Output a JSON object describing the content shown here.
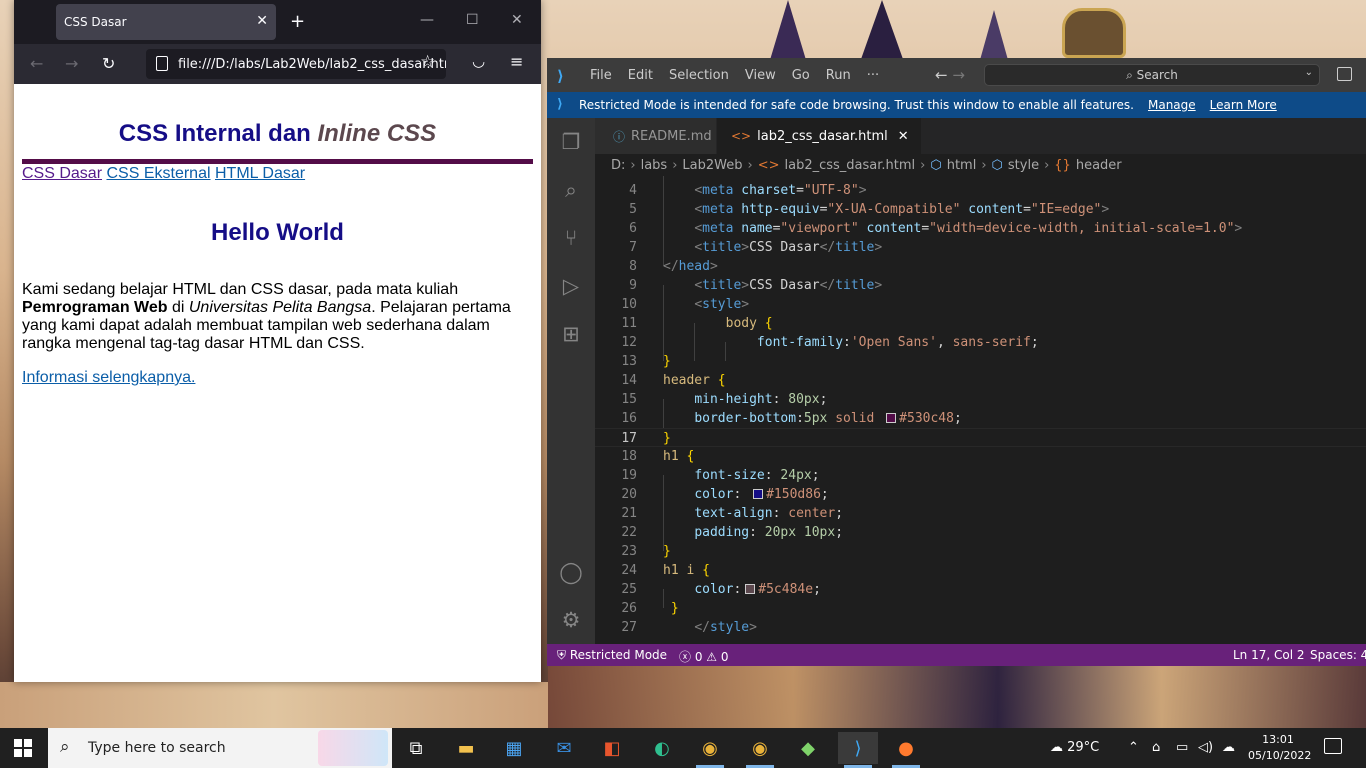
{
  "browser": {
    "tab_title": "CSS Dasar",
    "url": "file:///D:/labs/Lab2Web/lab2_css_dasar.html",
    "page": {
      "h1_text": "CSS Internal dan ",
      "h1_italic": "Inline CSS",
      "nav": [
        "CSS Dasar",
        "CSS Eksternal",
        "HTML Dasar"
      ],
      "h2": "Hello World",
      "p_part1": "Kami sedang belajar HTML dan CSS dasar, pada mata kuliah ",
      "p_bold": "Pemrograman Web",
      "p_part2": " di ",
      "p_italic": "Universitas Pelita Bangsa",
      "p_part3": ". Pelajaran pertama yang kami dapat adalah membuat tampilan web sederhana dalam rangka mengenal tag-tag dasar HTML dan CSS.",
      "more_link": "Informasi selengkapnya."
    }
  },
  "vscode": {
    "menu": [
      "File",
      "Edit",
      "Selection",
      "View",
      "Go",
      "Run",
      "···"
    ],
    "search_placeholder": "Search",
    "banner": {
      "text": "Restricted Mode is intended for safe code browsing. Trust this window to enable all features.",
      "manage": "Manage",
      "learn_more": "Learn More"
    },
    "tabs": [
      {
        "label": "README.md",
        "active": false
      },
      {
        "label": "lab2_css_dasar.html",
        "active": true
      }
    ],
    "breadcrumb": [
      "D:",
      "labs",
      "Lab2Web",
      "lab2_css_dasar.html",
      "html",
      "style",
      "header"
    ],
    "status": {
      "restricted": "Restricted Mode",
      "errors": "0",
      "warnings": "0",
      "position": "Ln 17, Col 2",
      "spaces": "Spaces: 4"
    },
    "current_line": 17,
    "colors": {
      "header_border": "#530c48",
      "h1_color": "#150d86",
      "h1_i_color": "#5c484e"
    }
  },
  "taskbar": {
    "search_placeholder": "Type here to search",
    "weather": "29°C",
    "time": "13:01",
    "date": "05/10/2022"
  }
}
